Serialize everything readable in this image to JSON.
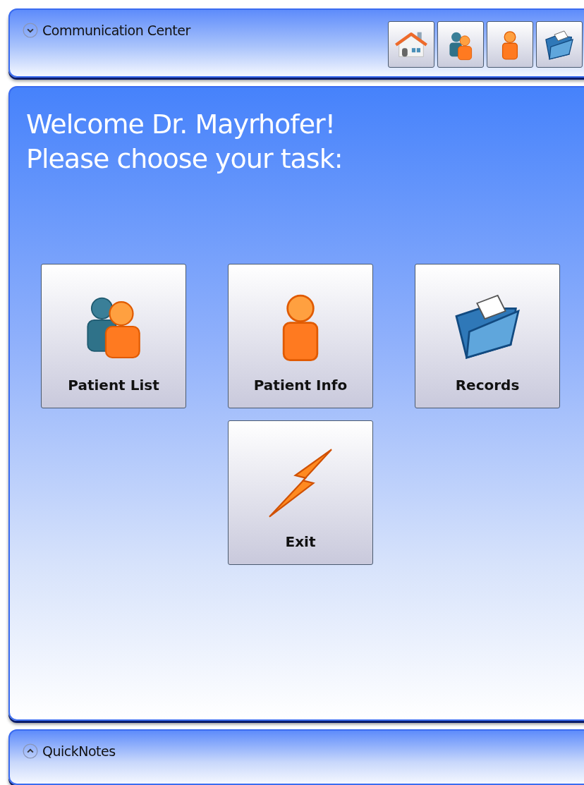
{
  "top_panel": {
    "title": "Communication Center",
    "expanded": true,
    "toolbar": [
      {
        "kind": "home"
      },
      {
        "kind": "people"
      },
      {
        "kind": "person"
      },
      {
        "kind": "folder"
      }
    ]
  },
  "main": {
    "greeting": "Welcome Dr. Mayrhofer!",
    "prompt": "Please choose your task:",
    "tasks": [
      {
        "label": "Patient List",
        "kind": "people"
      },
      {
        "label": "Patient Info",
        "kind": "person"
      },
      {
        "label": "Records",
        "kind": "folder"
      },
      {
        "label": "Exit",
        "kind": "bolt"
      }
    ]
  },
  "bottom_panel": {
    "title": "QuickNotes",
    "expanded": false
  }
}
